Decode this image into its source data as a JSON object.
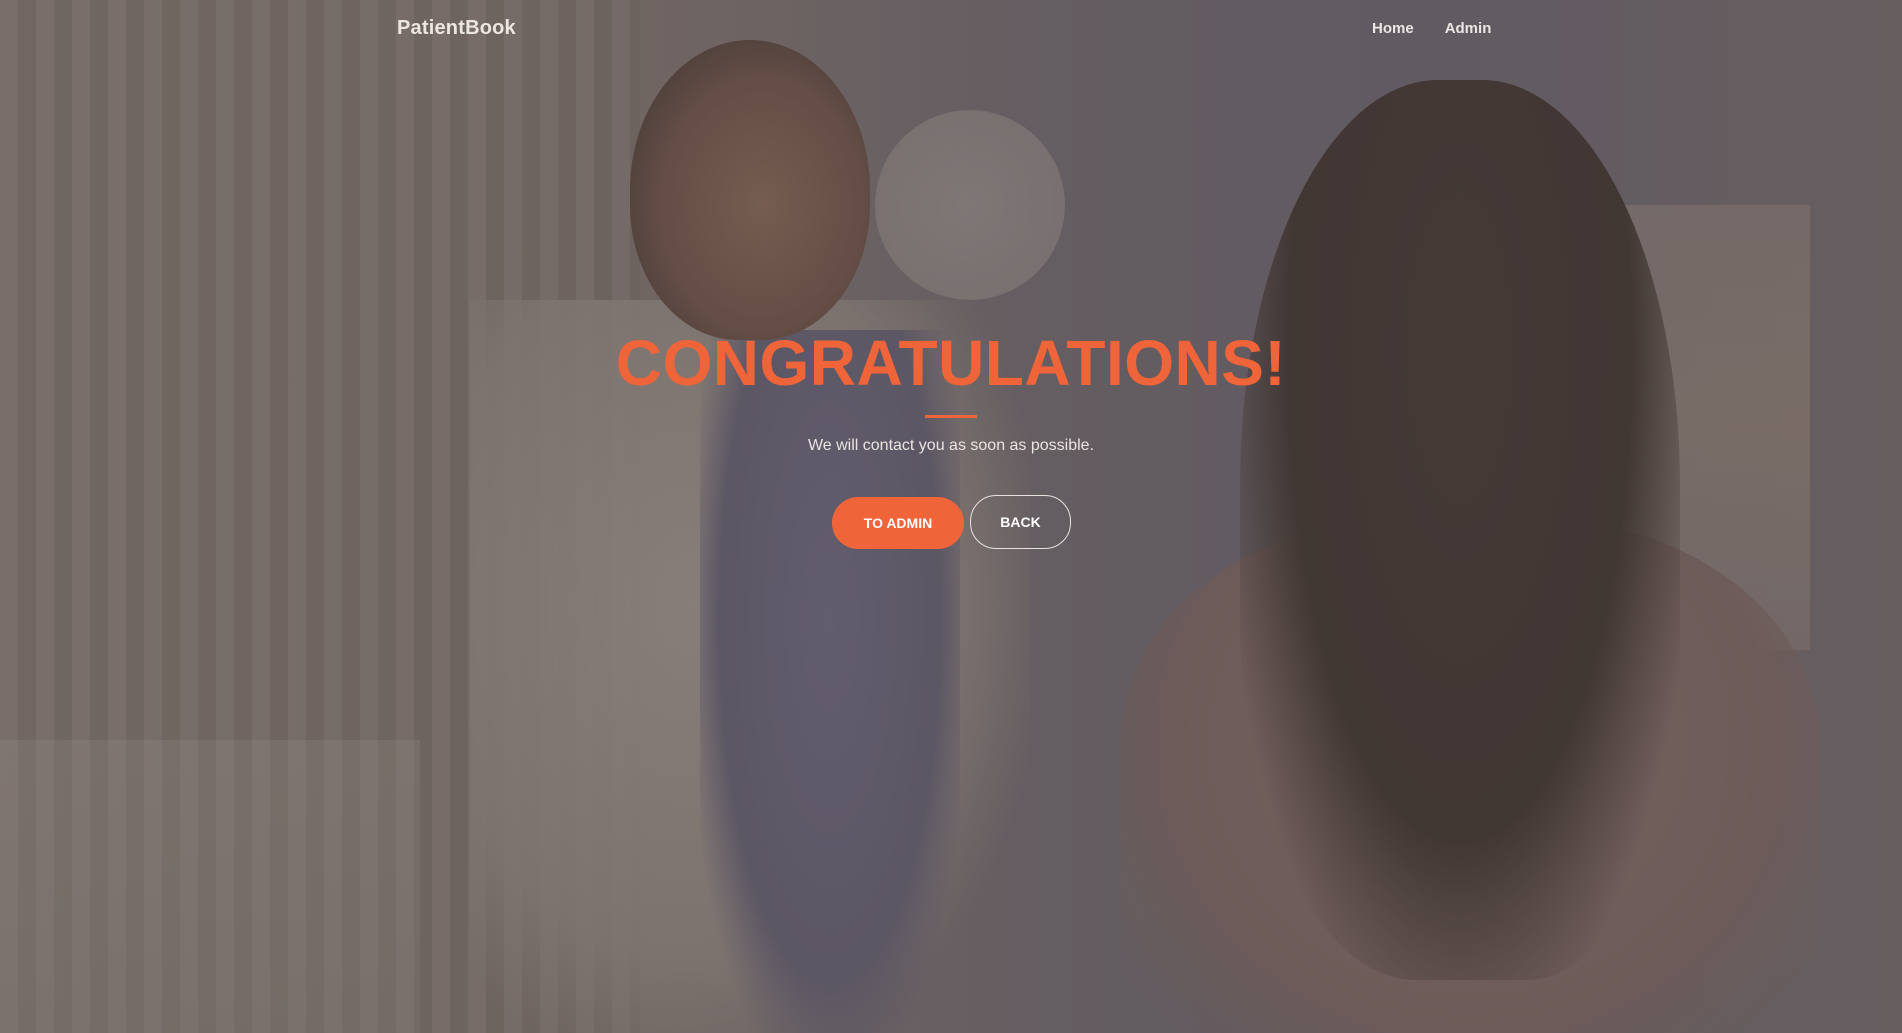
{
  "navbar": {
    "brand": "PatientBook",
    "links": [
      {
        "label": "Home"
      },
      {
        "label": "Admin"
      }
    ]
  },
  "hero": {
    "headline": "CONGRATULATIONS!",
    "subtitle": "We will contact you as soon as possible.",
    "primary_button": "TO ADMIN",
    "secondary_button": "BACK"
  },
  "colors": {
    "accent": "#f0643a",
    "text_light": "#ece6e3",
    "overlay": "#6b6260"
  }
}
